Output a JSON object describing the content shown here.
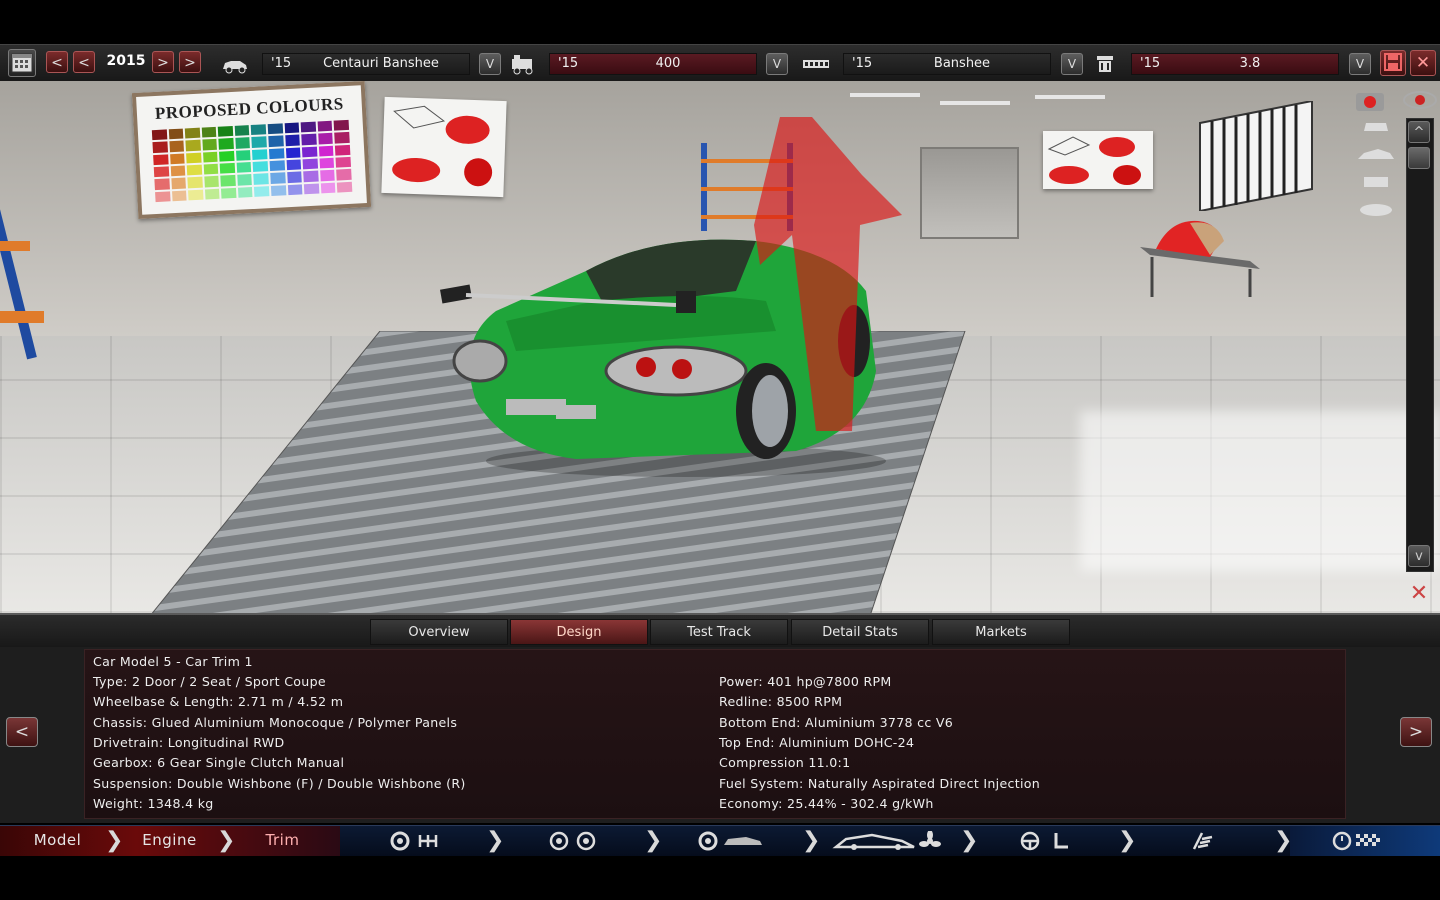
{
  "toolbar": {
    "year": "2015",
    "prev_label": "<",
    "next_label": ">",
    "model": {
      "year": "'15",
      "name": "Centauri Banshee"
    },
    "engine": {
      "year": "'15",
      "name": "400"
    },
    "trim": {
      "year": "'15",
      "name": "Banshee"
    },
    "engine_variant": {
      "year": "'15",
      "name": "3.8"
    },
    "dropdown_label": "V"
  },
  "viewport": {
    "poster_title": "PROPOSED COLOURS",
    "scroll_up_label": "^",
    "scroll_down_label": "v"
  },
  "tabs": [
    {
      "label": "Overview",
      "active": false
    },
    {
      "label": "Design",
      "active": true
    },
    {
      "label": "Test Track",
      "active": false
    },
    {
      "label": "Detail Stats",
      "active": false
    },
    {
      "label": "Markets",
      "active": false
    }
  ],
  "info": {
    "title": "Car Model 5 - Car Trim 1",
    "left": [
      "Type: 2 Door / 2 Seat / Sport Coupe",
      "Wheelbase & Length: 2.71 m / 4.52 m",
      "Chassis: Glued Aluminium Monocoque / Polymer Panels",
      "Drivetrain: Longitudinal RWD",
      "Gearbox: 6 Gear Single Clutch Manual",
      "Suspension: Double Wishbone (F) / Double Wishbone (R)",
      "Weight: 1348.4 kg"
    ],
    "right": [
      "Power: 401 hp@7800 RPM",
      "Redline: 8500 RPM",
      "Bottom End: Aluminium 3778 cc V6",
      "Top End: Aluminium DOHC-24",
      "Compression 11.0:1",
      "Fuel System: Naturally Aspirated Direct Injection",
      "Economy: 25.44% - 302.4 g/kWh"
    ],
    "prev_label": "<",
    "next_label": ">"
  },
  "steps": {
    "model": "Model",
    "engine": "Engine",
    "trim": "Trim"
  },
  "colors": {
    "accent_red": "#8a3636",
    "car_green": "#1fa53a",
    "nav_blue": "#0c1a33"
  }
}
